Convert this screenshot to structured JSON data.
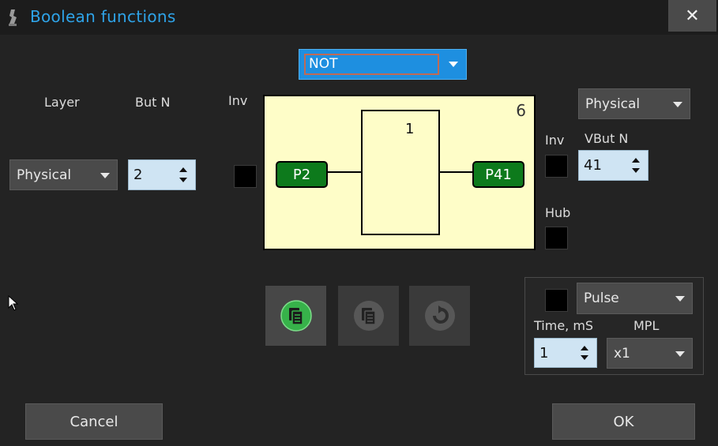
{
  "window": {
    "title": "Boolean functions",
    "close_label": "✕"
  },
  "function_select": {
    "value": "NOT"
  },
  "input": {
    "layer_label": "Layer",
    "button_label": "But N",
    "inv_label": "Inv",
    "layer_value": "Physical",
    "button_value": "2"
  },
  "diagram": {
    "corner_number": "6",
    "gate_label": "1",
    "input_port": "P2",
    "output_port": "P41"
  },
  "output": {
    "layer_value": "Physical",
    "inv_label": "Inv",
    "vbut_label": "VBut N",
    "vbut_value": "41",
    "hub_label": "Hub"
  },
  "pulse": {
    "mode_value": "Pulse",
    "time_label": "Time, mS",
    "mpl_label": "MPL",
    "time_value": "1",
    "mpl_value": "x1"
  },
  "footer": {
    "cancel_label": "Cancel",
    "ok_label": "OK"
  }
}
